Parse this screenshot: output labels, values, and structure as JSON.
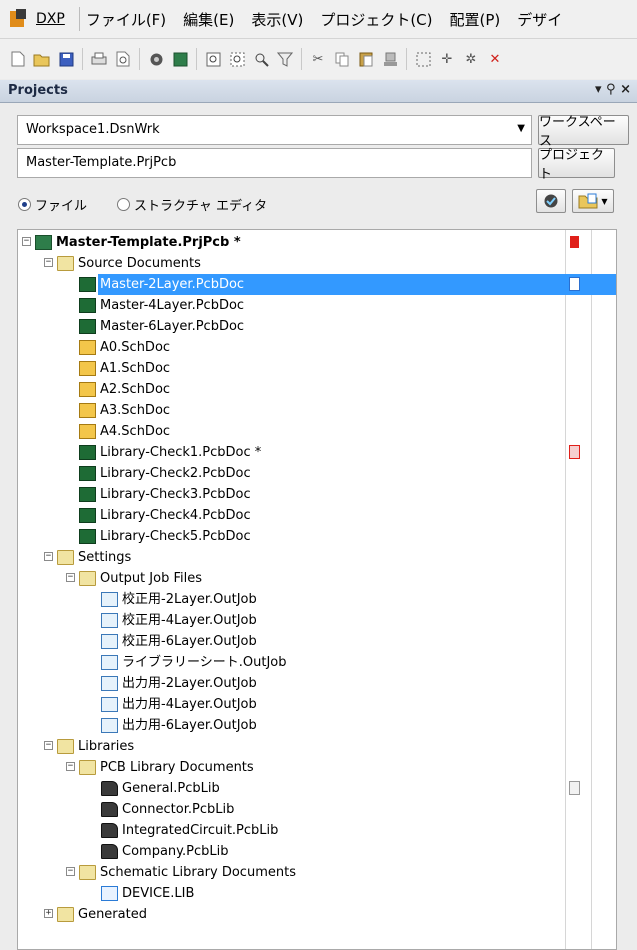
{
  "menubar": {
    "app_label": "DXP",
    "items": [
      "ファイル(F)",
      "編集(E)",
      "表示(V)",
      "プロジェクト(C)",
      "配置(P)",
      "デザイ"
    ]
  },
  "toolbar": {
    "icons": [
      "new-document-icon",
      "open-folder-icon",
      "save-icon",
      "print-icon",
      "print-preview-icon",
      "open-project-icon",
      "device-sheet-icon",
      "zoom-fit-icon",
      "zoom-area-icon",
      "zoom-selected-icon",
      "zoom-filter-icon",
      "cut-icon",
      "copy-icon",
      "paste-icon",
      "rubber-stamp-icon",
      "select-area-icon",
      "move-icon",
      "clear-icon",
      "cross-probe-icon"
    ]
  },
  "panel": {
    "title": "Projects",
    "controls": "▾ ⚲ ×"
  },
  "workspace": {
    "value": "Workspace1.DsnWrk",
    "button_label": "ワークスペース"
  },
  "project": {
    "value": "Master-Template.PrjPcb",
    "button_label": "プロジェクト"
  },
  "view_mode": {
    "options": [
      "ファイル",
      "ストラクチャ エディタ"
    ],
    "selected": 0
  },
  "tree": {
    "items": [
      {
        "label": "Master-Template.PrjPcb *",
        "level": 0,
        "icon": "pcb-project-icon",
        "toggle": "−",
        "bold": true,
        "modified": "red"
      },
      {
        "label": "Source Documents",
        "level": 1,
        "icon": "folder-icon",
        "toggle": "−"
      },
      {
        "label": "Master-2Layer.PcbDoc",
        "level": 2,
        "icon": "pcb-document-icon",
        "selected": true,
        "modified": "white"
      },
      {
        "label": "Master-4Layer.PcbDoc",
        "level": 2,
        "icon": "pcb-document-icon"
      },
      {
        "label": "Master-6Layer.PcbDoc",
        "level": 2,
        "icon": "pcb-document-icon"
      },
      {
        "label": "A0.SchDoc",
        "level": 2,
        "icon": "schematic-document-icon"
      },
      {
        "label": "A1.SchDoc",
        "level": 2,
        "icon": "schematic-document-icon"
      },
      {
        "label": "A2.SchDoc",
        "level": 2,
        "icon": "schematic-document-icon"
      },
      {
        "label": "A3.SchDoc",
        "level": 2,
        "icon": "schematic-document-icon"
      },
      {
        "label": "A4.SchDoc",
        "level": 2,
        "icon": "schematic-document-icon"
      },
      {
        "label": "Library-Check1.PcbDoc *",
        "level": 2,
        "icon": "pcb-document-icon",
        "modified": "pink"
      },
      {
        "label": "Library-Check2.PcbDoc",
        "level": 2,
        "icon": "pcb-document-icon"
      },
      {
        "label": "Library-Check3.PcbDoc",
        "level": 2,
        "icon": "pcb-document-icon"
      },
      {
        "label": "Library-Check4.PcbDoc",
        "level": 2,
        "icon": "pcb-document-icon"
      },
      {
        "label": "Library-Check5.PcbDoc",
        "level": 2,
        "icon": "pcb-document-icon"
      },
      {
        "label": "Settings",
        "level": 1,
        "icon": "folder-icon",
        "toggle": "−"
      },
      {
        "label": "Output Job Files",
        "level": 2,
        "icon": "folder-icon",
        "toggle": "−"
      },
      {
        "label": "校正用-2Layer.OutJob",
        "level": 3,
        "icon": "output-job-icon"
      },
      {
        "label": "校正用-4Layer.OutJob",
        "level": 3,
        "icon": "output-job-icon"
      },
      {
        "label": "校正用-6Layer.OutJob",
        "level": 3,
        "icon": "output-job-icon"
      },
      {
        "label": "ライブラリーシート.OutJob",
        "level": 3,
        "icon": "output-job-icon"
      },
      {
        "label": "出力用-2Layer.OutJob",
        "level": 3,
        "icon": "output-job-icon"
      },
      {
        "label": "出力用-4Layer.OutJob",
        "level": 3,
        "icon": "output-job-icon"
      },
      {
        "label": "出力用-6Layer.OutJob",
        "level": 3,
        "icon": "output-job-icon"
      },
      {
        "label": "Libraries",
        "level": 1,
        "icon": "folder-icon",
        "toggle": "−"
      },
      {
        "label": "PCB Library Documents",
        "level": 2,
        "icon": "folder-icon",
        "toggle": "−"
      },
      {
        "label": "General.PcbLib",
        "level": 3,
        "icon": "pcb-library-icon",
        "modified": "gray"
      },
      {
        "label": "Connector.PcbLib",
        "level": 3,
        "icon": "pcb-library-icon"
      },
      {
        "label": "IntegratedCircuit.PcbLib",
        "level": 3,
        "icon": "pcb-library-icon"
      },
      {
        "label": "Company.PcbLib",
        "level": 3,
        "icon": "pcb-library-icon"
      },
      {
        "label": "Schematic Library Documents",
        "level": 2,
        "icon": "folder-icon",
        "toggle": "−"
      },
      {
        "label": "DEVICE.LIB",
        "level": 3,
        "icon": "schematic-library-icon"
      },
      {
        "label": "Generated",
        "level": 1,
        "icon": "folder-icon",
        "toggle": "+"
      }
    ]
  },
  "colors": {
    "selection": "#3399ff",
    "panel_header": "#c9d3e0",
    "modified_red": "#e0201a"
  }
}
